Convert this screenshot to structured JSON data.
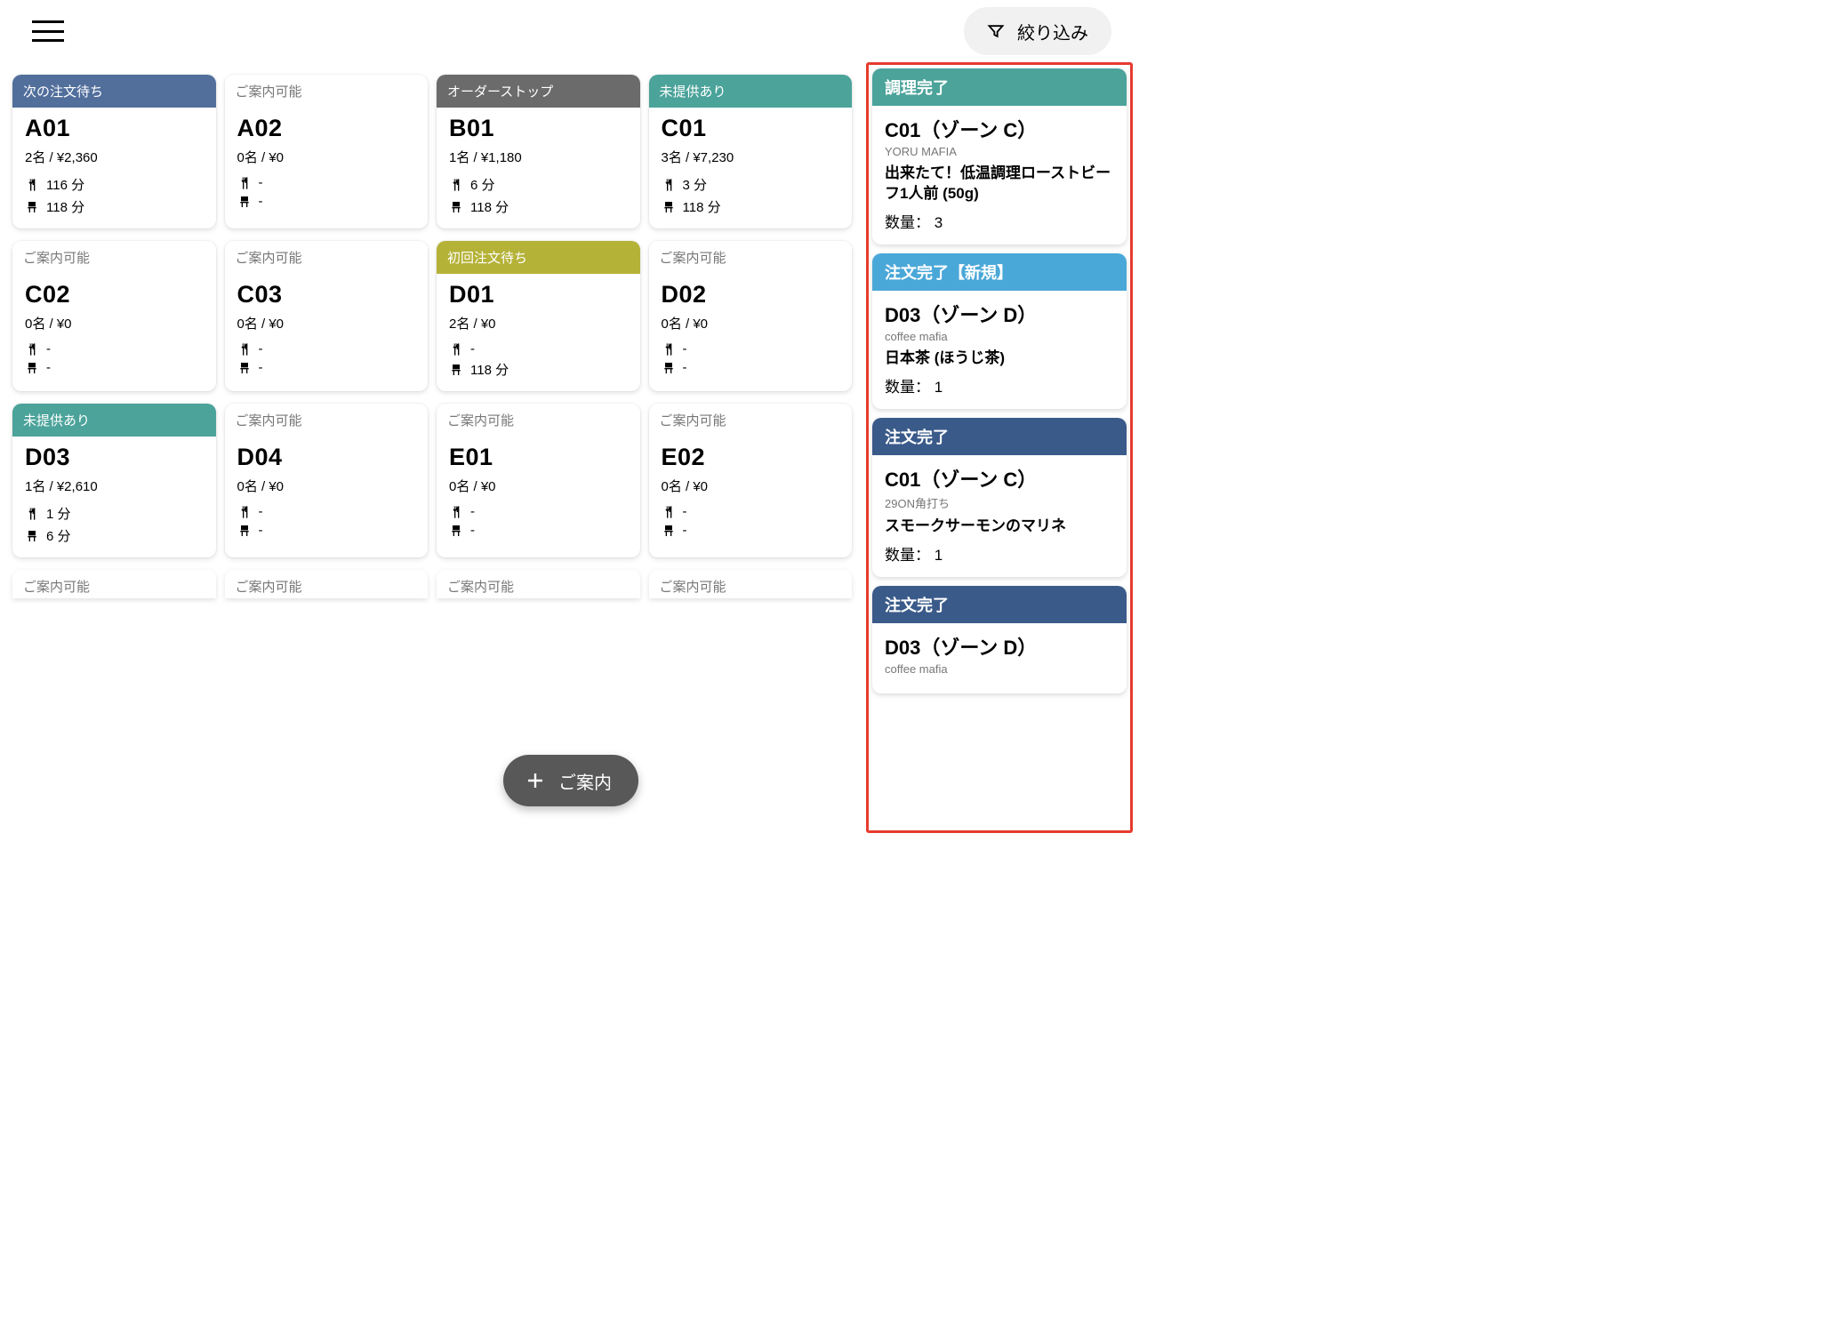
{
  "topbar": {
    "filter_label": "絞り込み"
  },
  "fab_label": "ご案内",
  "status_labels": {
    "available": "ご案内可能",
    "next_order": "次の注文待ち",
    "order_stop": "オーダーストップ",
    "unserved": "未提供あり",
    "first_order": "初回注文待ち"
  },
  "tables": [
    {
      "id": "A01",
      "status": "next_order",
      "info": "2名 / ¥2,360",
      "eat": "116 分",
      "seat": "118 分"
    },
    {
      "id": "A02",
      "status": "available",
      "info": "0名 / ¥0",
      "eat": "-",
      "seat": "-"
    },
    {
      "id": "B01",
      "status": "order_stop",
      "info": "1名 / ¥1,180",
      "eat": "6 分",
      "seat": "118 分"
    },
    {
      "id": "C01",
      "status": "unserved",
      "info": "3名 / ¥7,230",
      "eat": "3 分",
      "seat": "118 分"
    },
    {
      "id": "C02",
      "status": "available",
      "info": "0名 / ¥0",
      "eat": "-",
      "seat": "-"
    },
    {
      "id": "C03",
      "status": "available",
      "info": "0名 / ¥0",
      "eat": "-",
      "seat": "-"
    },
    {
      "id": "D01",
      "status": "first_order",
      "info": "2名 / ¥0",
      "eat": "-",
      "seat": "118 分"
    },
    {
      "id": "D02",
      "status": "available",
      "info": "0名 / ¥0",
      "eat": "-",
      "seat": "-"
    },
    {
      "id": "D03",
      "status": "unserved",
      "info": "1名 / ¥2,610",
      "eat": "1 分",
      "seat": "6 分"
    },
    {
      "id": "D04",
      "status": "available",
      "info": "0名 / ¥0",
      "eat": "-",
      "seat": "-"
    },
    {
      "id": "E01",
      "status": "available",
      "info": "0名 / ¥0",
      "eat": "-",
      "seat": "-"
    },
    {
      "id": "E02",
      "status": "available",
      "info": "0名 / ¥0",
      "eat": "-",
      "seat": "-"
    }
  ],
  "peek_row": [
    "ご案内可能",
    "ご案内可能",
    "ご案内可能",
    "ご案内可能"
  ],
  "notifications": [
    {
      "header": "調理完了",
      "header_class": "nh-teal",
      "title": "C01（ゾーン C）",
      "sub": "YORU MAFIA",
      "item": "出来たて！低温調理ローストビーフ1人前 (50g)",
      "qty": "数量： 3"
    },
    {
      "header": "注文完了【新規】",
      "header_class": "nh-sky",
      "title": "D03（ゾーン D）",
      "sub": "coffee mafia",
      "item": "日本茶 (ほうじ茶)",
      "qty": "数量： 1"
    },
    {
      "header": "注文完了",
      "header_class": "nh-navy",
      "title": "C01（ゾーン C）",
      "sub": "29ON角打ち",
      "item": "スモークサーモンのマリネ",
      "qty": "数量： 1"
    },
    {
      "header": "注文完了",
      "header_class": "nh-navy",
      "title": "D03（ゾーン D）",
      "sub": "coffee mafia",
      "item": "",
      "qty": ""
    }
  ]
}
